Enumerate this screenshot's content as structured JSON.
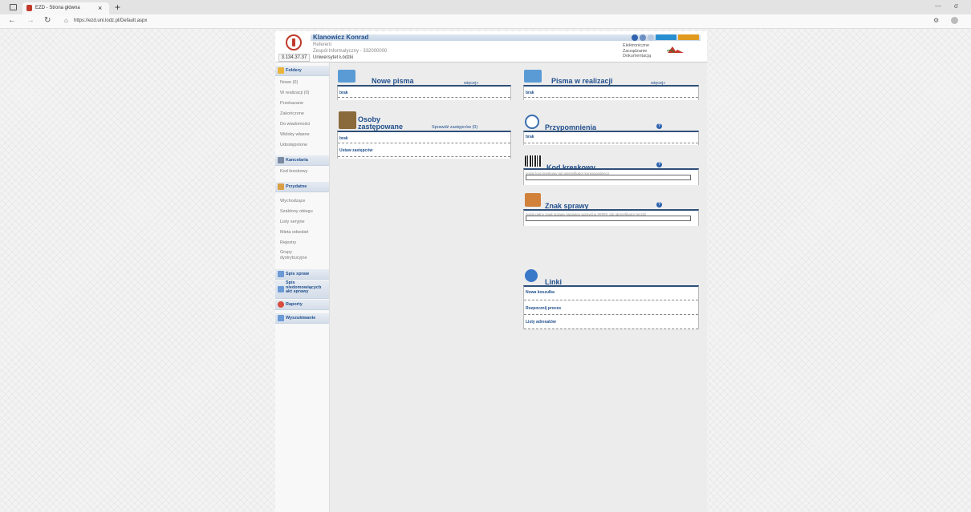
{
  "browser": {
    "tab_title": "EZD - Strona główna",
    "tab_close": "×",
    "new_tab": "+",
    "url": "https://ezd.uni.lodz.pl/Default.aspx",
    "back": "←",
    "forward": "→",
    "reload": "↻",
    "min": "—",
    "max": "σ"
  },
  "header": {
    "ip": "3.134.37.37",
    "user_name": "Klanowicz Konrad",
    "user_role": "Referent",
    "user_team": "Zespół Informatyczny - 332000000",
    "user_unit": "Uniwersytet Łódzki",
    "brand_lines": [
      "Elektroniczne",
      "Zarządzanie",
      "Dokumentacją"
    ]
  },
  "sidebar": {
    "sections": [
      {
        "label": "Foldery",
        "color": "#e9b43c"
      },
      {
        "label": "Kancelaria",
        "color": "#7a8aa3"
      },
      {
        "label": "Przydatne",
        "color": "#d9a043"
      },
      {
        "label": "Spis spraw",
        "color": "#6b9ad6"
      },
      {
        "label": "Spis niedomowiącycb akt sprawy",
        "color": "#6b9ad6"
      },
      {
        "label": "Raporty",
        "color": "#d94b3c"
      },
      {
        "label": "Wyszukiwanie",
        "color": "#6b9ad6"
      }
    ],
    "foldery": [
      "Nowe (0)",
      "W realizacji (0)",
      "Przekazane",
      "Zakończone",
      "Do wiadomości",
      "Widoky własne",
      "Udostępnione"
    ],
    "kancelaria": [
      "Kod kreskowy"
    ],
    "przydatne": [
      "Wychodzące",
      "Szablony obiegu",
      "Listy seryjne",
      "Mieta odwołań",
      "Rejestry",
      "Grupy dystrybucyjne"
    ]
  },
  "widgets": {
    "nowe_pisma": {
      "title": "Nowe pisma",
      "more": "więcej»",
      "empty": "brak",
      "icon_color": "#5b9bd5"
    },
    "pisma_realizacji": {
      "title": "Pisma w realizacji",
      "more": "więcej»",
      "empty": "brak",
      "icon_color": "#5b9bd5"
    },
    "osoby": {
      "title_line1": "Osoby",
      "title_line2": "zastępowane",
      "more": "Sprawdź zastępców (0)",
      "empty": "brak",
      "action": "Ustaw zastępców",
      "icon_color": "#8a6a3a"
    },
    "przypomnienia": {
      "title": "Przypomnienia",
      "empty": "brak",
      "help": "?",
      "icon_color": "#3a6fb0"
    },
    "kod_kreskowy": {
      "title": "Kod kreskowy",
      "description": "podaj kod kreskowy lub identyfikator korespondencji",
      "help": "?",
      "icon_color": "#222222"
    },
    "znak_sprawy": {
      "title": "Znak sprawy",
      "description": "podaj pełny znak sprawy (wpisany pomyśl w #####, lub identyfikator teczki)",
      "help": "?",
      "icon_color": "#d1813a"
    },
    "linki": {
      "title": "Linki",
      "items": [
        "Nowa koszulka",
        "Rozpocznij proces",
        "Listy adresatów"
      ],
      "icon_color": "#3a78c8"
    }
  },
  "colors": {
    "accent": "#1f4e8c",
    "header_bar": "#c8d6e6",
    "logo_red": "#c0392b"
  }
}
